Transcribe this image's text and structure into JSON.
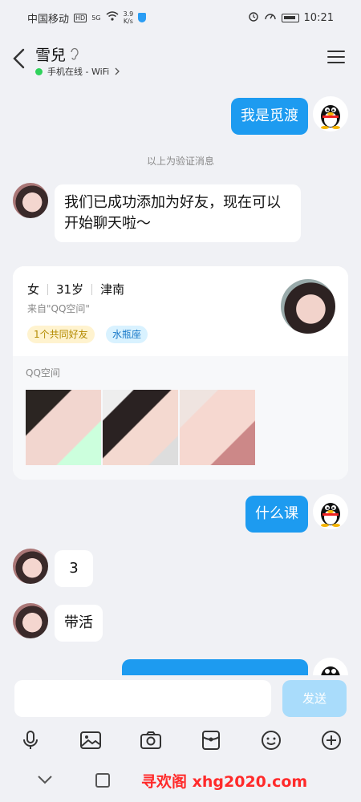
{
  "status_bar": {
    "carrier": "中国移动",
    "hd": "HD",
    "network": "5G",
    "speed_value": "3.9",
    "speed_unit": "K/s",
    "time": "10:21"
  },
  "header": {
    "contact_name": "雪兒",
    "online_status": "手机在线 - WiFi"
  },
  "messages": [
    {
      "side": "out",
      "text": "我是觅渡"
    },
    {
      "side": "system",
      "text": "以上为验证消息"
    },
    {
      "side": "in",
      "text": "我们已成功添加为好友，现在可以开始聊天啦～"
    },
    {
      "side": "out",
      "text": "什么课"
    },
    {
      "side": "in",
      "text": "3"
    },
    {
      "side": "in",
      "text": "带活"
    }
  ],
  "profile_card": {
    "gender": "女",
    "age": "31岁",
    "location": "津南",
    "source": "来自\"QQ空间\"",
    "tag_friends": "1个共同好友",
    "tag_zodiac": "水瓶座",
    "section_label": "QQ空间"
  },
  "input_bar": {
    "placeholder": "",
    "send_label": "发送"
  },
  "watermark": "寻欢阁 xhg2020.com",
  "colors": {
    "bubble_out": "#1d9bf0",
    "bubble_in": "#ffffff",
    "send_disabled": "#a9dcfb",
    "online_dot": "#2fd25b",
    "watermark": "#ff2a2a"
  }
}
